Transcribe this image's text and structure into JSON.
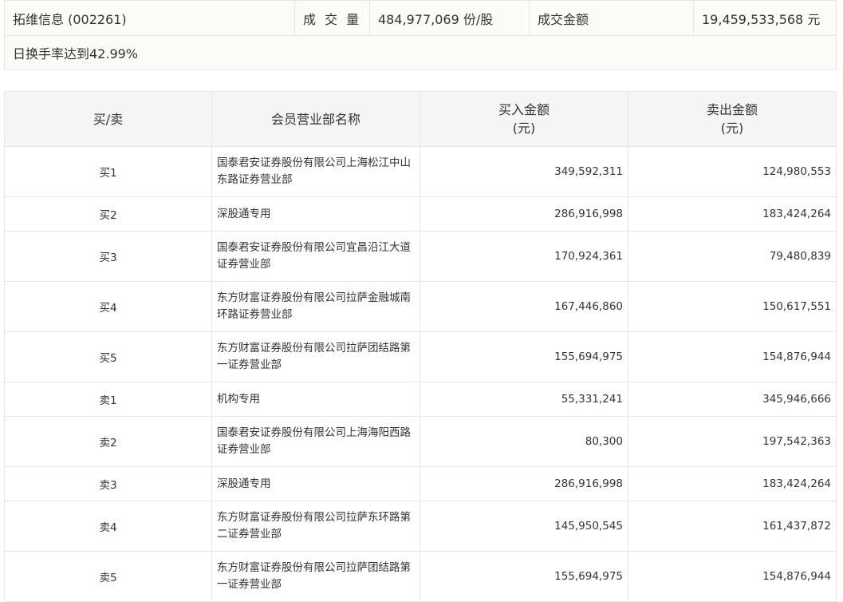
{
  "summary": {
    "stock_name": "拓维信息 (002261)",
    "volume_label": "成 交 量",
    "volume_value": "484,977,069 份/股",
    "amount_label": "成交金额",
    "amount_value": "19,459,533,568 元",
    "note": "日换手率达到42.99%"
  },
  "table": {
    "headers": {
      "side": "买/卖",
      "name": "会员营业部名称",
      "buy_line1": "买入金额",
      "buy_line2": "(元)",
      "sell_line1": "卖出金额",
      "sell_line2": "(元)"
    },
    "rows": [
      {
        "side": "买1",
        "name": "国泰君安证券股份有限公司上海松江中山东路证券营业部",
        "buy": "349,592,311",
        "sell": "124,980,553"
      },
      {
        "side": "买2",
        "name": "深股通专用",
        "buy": "286,916,998",
        "sell": "183,424,264"
      },
      {
        "side": "买3",
        "name": "国泰君安证券股份有限公司宜昌沿江大道证券营业部",
        "buy": "170,924,361",
        "sell": "79,480,839"
      },
      {
        "side": "买4",
        "name": "东方财富证券股份有限公司拉萨金融城南环路证券营业部",
        "buy": "167,446,860",
        "sell": "150,617,551"
      },
      {
        "side": "买5",
        "name": "东方财富证券股份有限公司拉萨团结路第一证券营业部",
        "buy": "155,694,975",
        "sell": "154,876,944"
      },
      {
        "side": "卖1",
        "name": "机构专用",
        "buy": "55,331,241",
        "sell": "345,946,666"
      },
      {
        "side": "卖2",
        "name": "国泰君安证券股份有限公司上海海阳西路证券营业部",
        "buy": "80,300",
        "sell": "197,542,363"
      },
      {
        "side": "卖3",
        "name": "深股通专用",
        "buy": "286,916,998",
        "sell": "183,424,264"
      },
      {
        "side": "卖4",
        "name": "东方财富证券股份有限公司拉萨东环路第二证券营业部",
        "buy": "145,950,545",
        "sell": "161,437,872"
      },
      {
        "side": "卖5",
        "name": "东方财富证券股份有限公司拉萨团结路第一证券营业部",
        "buy": "155,694,975",
        "sell": "154,876,944"
      }
    ]
  }
}
